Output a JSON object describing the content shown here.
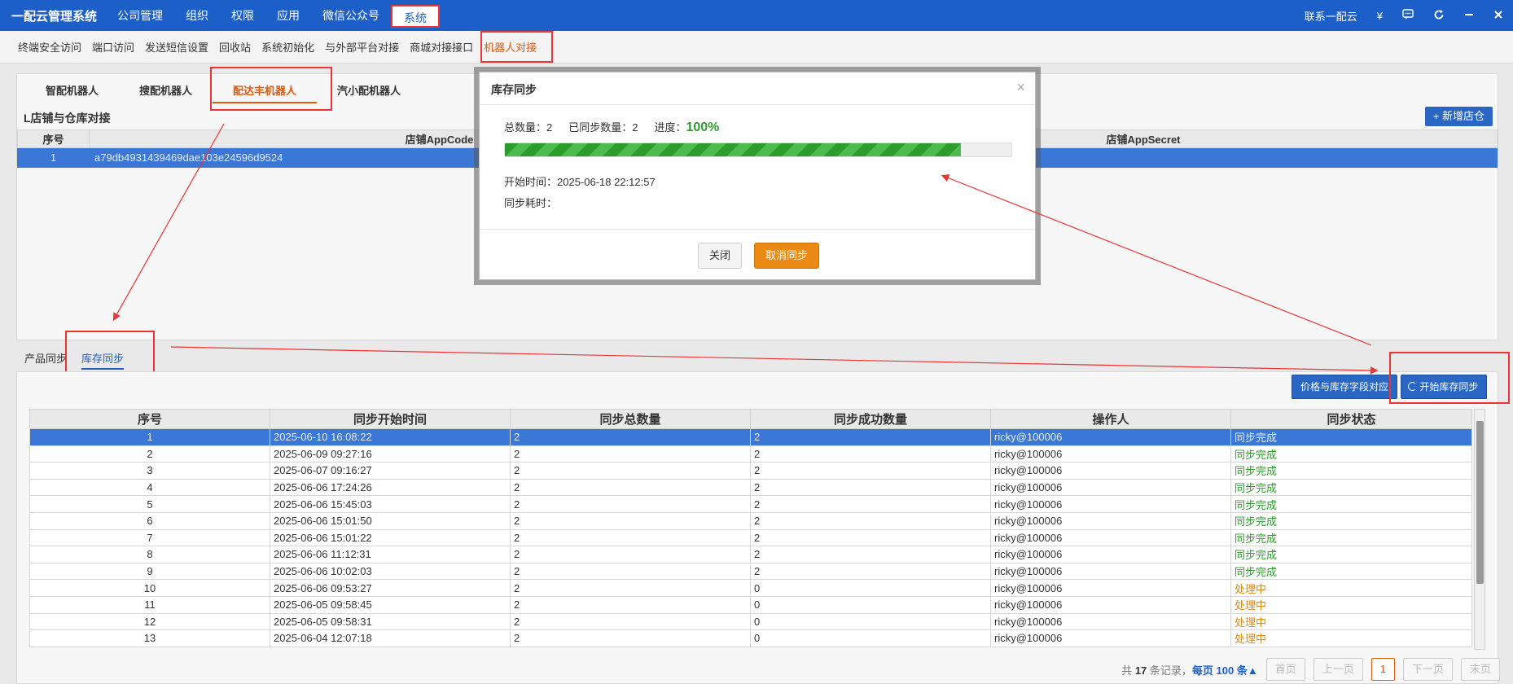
{
  "app_title": "一配云管理系统",
  "top_nav": [
    "公司管理",
    "组织",
    "权限",
    "应用",
    "微信公众号",
    "系统"
  ],
  "top_nav_active": "系统",
  "top_right": {
    "contact": "联系一配云",
    "currency_icon": "¥"
  },
  "sub_nav": [
    "终端安全访问",
    "端口访问",
    "发送短信设置",
    "回收站",
    "系统初始化",
    "与外部平台对接",
    "商城对接接口",
    "机器人对接"
  ],
  "robot_tabs": [
    "智配机器人",
    "搜配机器人",
    "配达丰机器人",
    "汽小配机器人"
  ],
  "panel_title": "L店铺与仓库对接",
  "add_button": "+ 新增店仓",
  "shop_table": {
    "headers": [
      "序号",
      "店铺AppCode",
      "店铺AppSecret"
    ],
    "rows": [
      [
        "1",
        "a79db4931439469dae103e24596d9524",
        ""
      ]
    ]
  },
  "lower_tabs": [
    "产品同步",
    "库存同步"
  ],
  "buttons": {
    "mapping": "价格与库存字段对应",
    "start_sync": "开始库存同步"
  },
  "sync_table": {
    "headers": [
      "序号",
      "同步开始时间",
      "同步总数量",
      "同步成功数量",
      "操作人",
      "同步状态"
    ],
    "rows": [
      [
        "1",
        "2025-06-10 16:08:22",
        "2",
        "2",
        "ricky@100006",
        "同步完成"
      ],
      [
        "2",
        "2025-06-09 09:27:16",
        "2",
        "2",
        "ricky@100006",
        "同步完成"
      ],
      [
        "3",
        "2025-06-07 09:16:27",
        "2",
        "2",
        "ricky@100006",
        "同步完成"
      ],
      [
        "4",
        "2025-06-06 17:24:26",
        "2",
        "2",
        "ricky@100006",
        "同步完成"
      ],
      [
        "5",
        "2025-06-06 15:45:03",
        "2",
        "2",
        "ricky@100006",
        "同步完成"
      ],
      [
        "6",
        "2025-06-06 15:01:50",
        "2",
        "2",
        "ricky@100006",
        "同步完成"
      ],
      [
        "7",
        "2025-06-06 15:01:22",
        "2",
        "2",
        "ricky@100006",
        "同步完成"
      ],
      [
        "8",
        "2025-06-06 11:12:31",
        "2",
        "2",
        "ricky@100006",
        "同步完成"
      ],
      [
        "9",
        "2025-06-06 10:02:03",
        "2",
        "2",
        "ricky@100006",
        "同步完成"
      ],
      [
        "10",
        "2025-06-06 09:53:27",
        "2",
        "0",
        "ricky@100006",
        "处理中"
      ],
      [
        "11",
        "2025-06-05 09:58:45",
        "2",
        "0",
        "ricky@100006",
        "处理中"
      ],
      [
        "12",
        "2025-06-05 09:58:31",
        "2",
        "0",
        "ricky@100006",
        "处理中"
      ],
      [
        "13",
        "2025-06-04 12:07:18",
        "2",
        "0",
        "ricky@100006",
        "处理中"
      ]
    ]
  },
  "pager": {
    "summary_pre": "共",
    "total": "17",
    "summary_mid": "条记录，",
    "page_size": "每页 100 条▲",
    "first": "首页",
    "prev": "上一页",
    "current": "1",
    "next": "下一页",
    "last": "末页"
  },
  "modal": {
    "title": "库存同步",
    "total_label": "总数量：2",
    "synced_label": "已同步数量：2",
    "progress_label": "进度：",
    "progress_text": "100%",
    "progress_value": 0.9,
    "start_time": "开始时间：2025-06-18 22:12:57",
    "elapsed": "同步耗时：",
    "close_btn": "关闭",
    "cancel_btn": "取消同步"
  },
  "colors": {
    "brand": "#1c5fc9",
    "accent": "#e05a10",
    "success": "#2f9a2f",
    "processing": "#e08a10",
    "selected_row": "#3a77d6"
  }
}
